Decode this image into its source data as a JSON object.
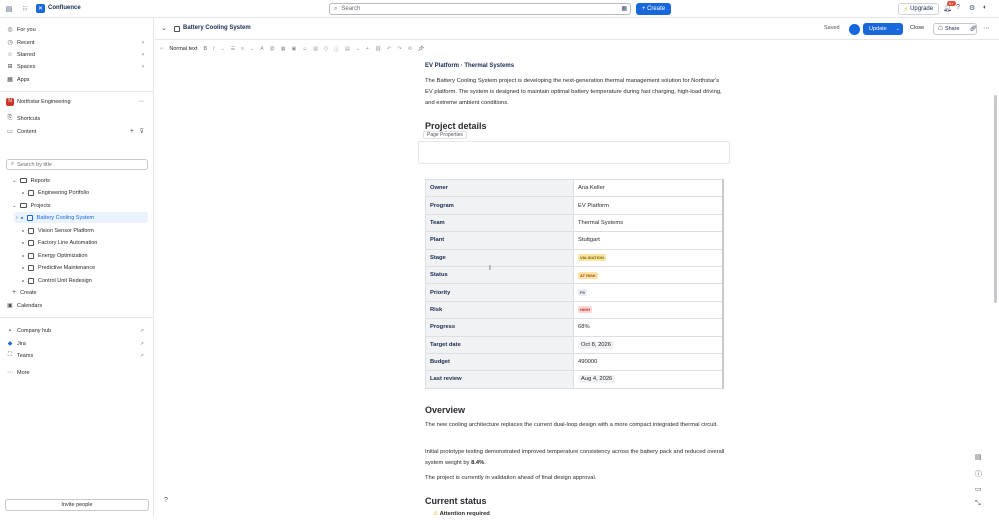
{
  "topbar": {
    "app_name": "Confluence",
    "search_placeholder": "Search",
    "create_label": "+ Create",
    "upgrade_label": "Upgrade",
    "notification_count": "9+"
  },
  "sidebar": {
    "nav": [
      {
        "label": "For you"
      },
      {
        "label": "Recent"
      },
      {
        "label": "Starred"
      },
      {
        "label": "Spaces"
      },
      {
        "label": "Apps"
      }
    ],
    "space_name": "Northstar Engineering",
    "shortcuts_label": "Shortcuts",
    "content_label": "Content",
    "search_placeholder": "Search by title",
    "tree": [
      {
        "label": "Reports"
      },
      {
        "label": "Engineering Portfolio"
      },
      {
        "label": "Projects"
      },
      {
        "label": "Battery Cooling System"
      },
      {
        "label": "Vision Sensor Platform"
      },
      {
        "label": "Factory Line Automation"
      },
      {
        "label": "Energy Optimization"
      },
      {
        "label": "Predictive Maintenance"
      },
      {
        "label": "Control Unit Redesign"
      }
    ],
    "create_label": "Create",
    "calendars_label": "Calendars",
    "apps": [
      {
        "label": "Company hub"
      },
      {
        "label": "Jira"
      },
      {
        "label": "Teams"
      }
    ],
    "more_label": "More",
    "invite_label": "Invite people"
  },
  "page_header": {
    "title": "Battery Cooling System",
    "saved_label": "Saved",
    "update_label": "Update",
    "close_label": "Close",
    "share_label": "Share"
  },
  "toolbar": {
    "text_style": "Normal text"
  },
  "page": {
    "breadcrumb": "EV Platform · Thermal Systems",
    "intro": "The Battery Cooling System project is developing the next-generation thermal management solution for Northstar's EV platform. The system is designed to maintain optimal battery temperature during fast charging, high-load driving, and extreme ambient conditions.",
    "project_details_heading": "Project details",
    "page_properties_label": "Page Properties",
    "properties": [
      {
        "key": "Owner",
        "value": "Ana Keller",
        "type": "text"
      },
      {
        "key": "Program",
        "value": "EV Platform",
        "type": "text"
      },
      {
        "key": "Team",
        "value": "Thermal Systems",
        "type": "text"
      },
      {
        "key": "Plant",
        "value": "Stuttgart",
        "type": "text"
      },
      {
        "key": "Stage",
        "value": "VALIDATION",
        "type": "lozenge",
        "bg": "#f8e6a0",
        "fg": "#7f5f01"
      },
      {
        "key": "Status",
        "value": "AT RISK",
        "type": "lozenge",
        "bg": "#fce4a6",
        "fg": "#a54800"
      },
      {
        "key": "Priority",
        "value": "P0",
        "type": "lozenge",
        "bg": "#eaecef",
        "fg": "#44546f"
      },
      {
        "key": "Risk",
        "value": "HIGH",
        "type": "lozenge",
        "bg": "#ffd5d2",
        "fg": "#ae2e24"
      },
      {
        "key": "Progress",
        "value": "68%",
        "type": "text"
      },
      {
        "key": "Target date",
        "value": "Oct 8, 2026",
        "type": "date"
      },
      {
        "key": "Budget",
        "value": "490000",
        "type": "text"
      },
      {
        "key": "Last review",
        "value": "Aug 4, 2026",
        "type": "date"
      }
    ],
    "overview_heading": "Overview",
    "overview_p1": "The new cooling architecture replaces the current dual-loop design with a more compact integrated thermal circuit.",
    "overview_p2_pre": "Initial prototype testing demonstrated improved temperature consistency across the battery pack and reduced overall system weight by ",
    "overview_p2_bold": "8.4%",
    "overview_p2_post": ".",
    "overview_p3": "The project is currently in validation ahead of final design approval.",
    "current_status_heading": "Current status",
    "attention_label": "Attention required"
  }
}
